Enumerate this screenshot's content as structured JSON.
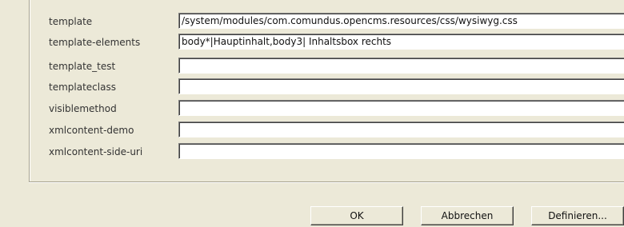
{
  "fields": [
    {
      "label": "template",
      "value": "/system/modules/com.comundus.opencms.resources/css/wysiwyg.css"
    },
    {
      "label": "template-elements",
      "value": "body*|Hauptinhalt,body3| Inhaltsbox rechts"
    },
    {
      "label": "template_test",
      "value": ""
    },
    {
      "label": "templateclass",
      "value": ""
    },
    {
      "label": "visiblemethod",
      "value": ""
    },
    {
      "label": "xmlcontent-demo",
      "value": ""
    },
    {
      "label": "xmlcontent-side-uri",
      "value": ""
    }
  ],
  "buttons": {
    "ok": "OK",
    "cancel": "Abbrechen",
    "define": "Definieren..."
  }
}
